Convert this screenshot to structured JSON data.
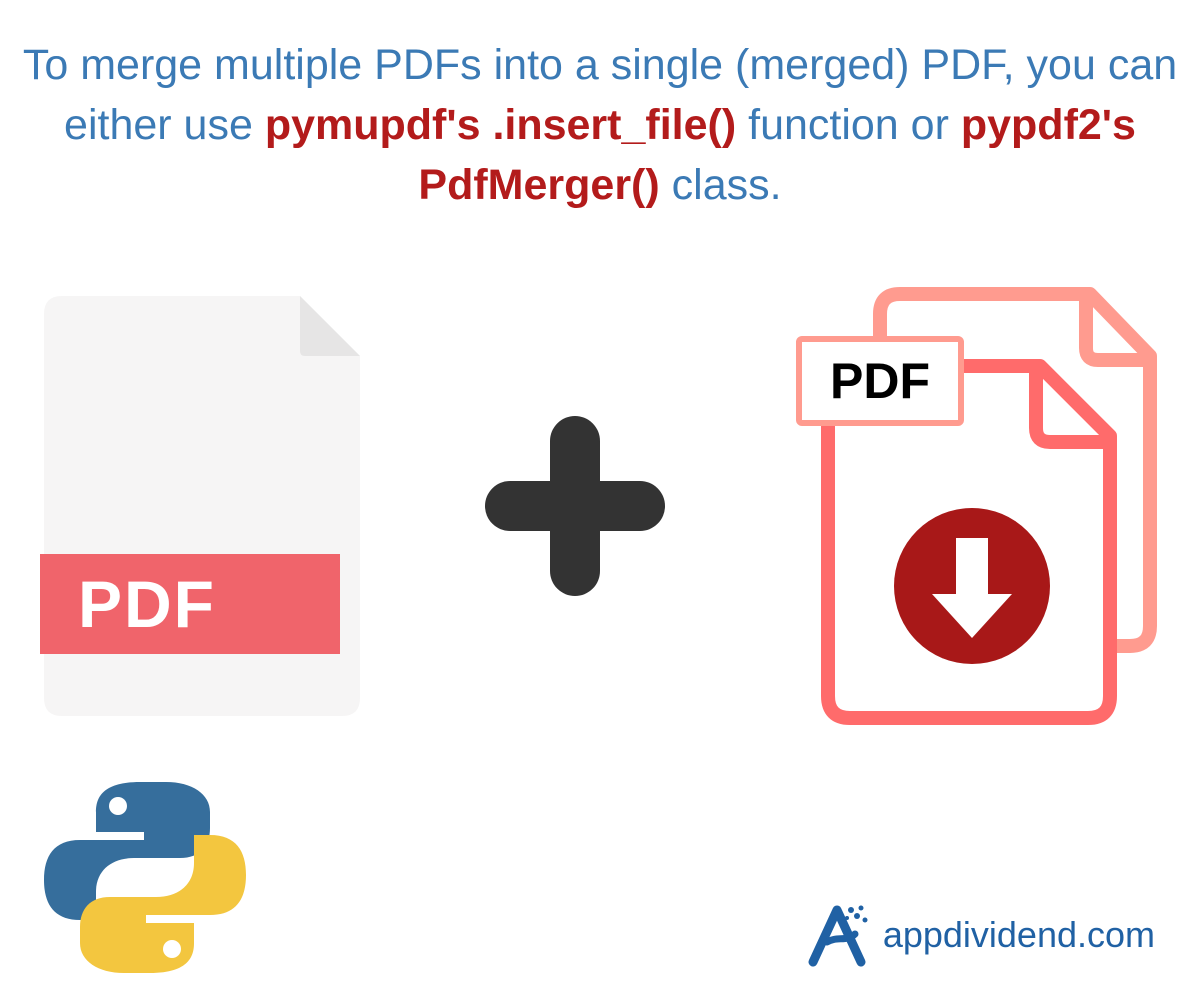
{
  "heading": {
    "part1": "To merge multiple PDFs into a single (merged) PDF, you can either use ",
    "hl1": "pymupdf's .insert_file()",
    "part2": " function or ",
    "hl2": "pypdf2's PdfMerger()",
    "part3": " class."
  },
  "left_pdf_label": "PDF",
  "right_pdf_label": "PDF",
  "brand_text": "appdividend.com",
  "colors": {
    "text_blue": "#3B7AB5",
    "text_red": "#B31B1B",
    "coral_band": "#F0646B",
    "coral_outline_light": "#FF9B8F",
    "coral_outline": "#FF6B6B",
    "download_circle": "#A81818",
    "plus": "#333333",
    "python_blue": "#366E9C",
    "python_yellow": "#F3C63F",
    "brand_blue": "#2061A4"
  }
}
